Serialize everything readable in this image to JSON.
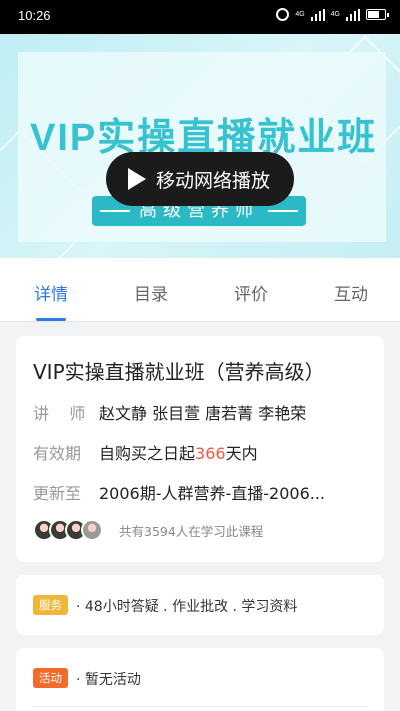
{
  "status_bar": {
    "time": "10:26",
    "net_tag_1": "4G",
    "net_tag_2": "4G"
  },
  "banner": {
    "title": "VIP实操直播就业班",
    "subtitle": "高级营养师",
    "play_label": "移动网络播放",
    "accent_color": "#37c2cf"
  },
  "tabs": [
    {
      "label": "详情",
      "active": true
    },
    {
      "label": "目录",
      "active": false
    },
    {
      "label": "评价",
      "active": false
    },
    {
      "label": "互动",
      "active": false
    }
  ],
  "course": {
    "title": "VIP实操直播就业班（营养高级）",
    "teacher_key": "讲    师",
    "teachers": "赵文静 张目萱 唐若菁 李艳荣",
    "validity_key": "有效期",
    "validity_prefix": "自购买之日起",
    "validity_days": "366",
    "validity_suffix": "天内",
    "update_key": "更新至",
    "update_value": "2006期-人群营养-直播-2006...",
    "learners_text": "共有3594人在学习此课程"
  },
  "service": {
    "badge": "服务",
    "text": "· 48小时答疑 . 作业批改 . 学习资料"
  },
  "activity": {
    "badge": "活动",
    "text": "· 暂无活动"
  },
  "colors": {
    "primary": "#2e7be6",
    "highlight": "#f05a3d",
    "service_badge": "#f0b63a",
    "activity_badge": "#f26b2b"
  }
}
